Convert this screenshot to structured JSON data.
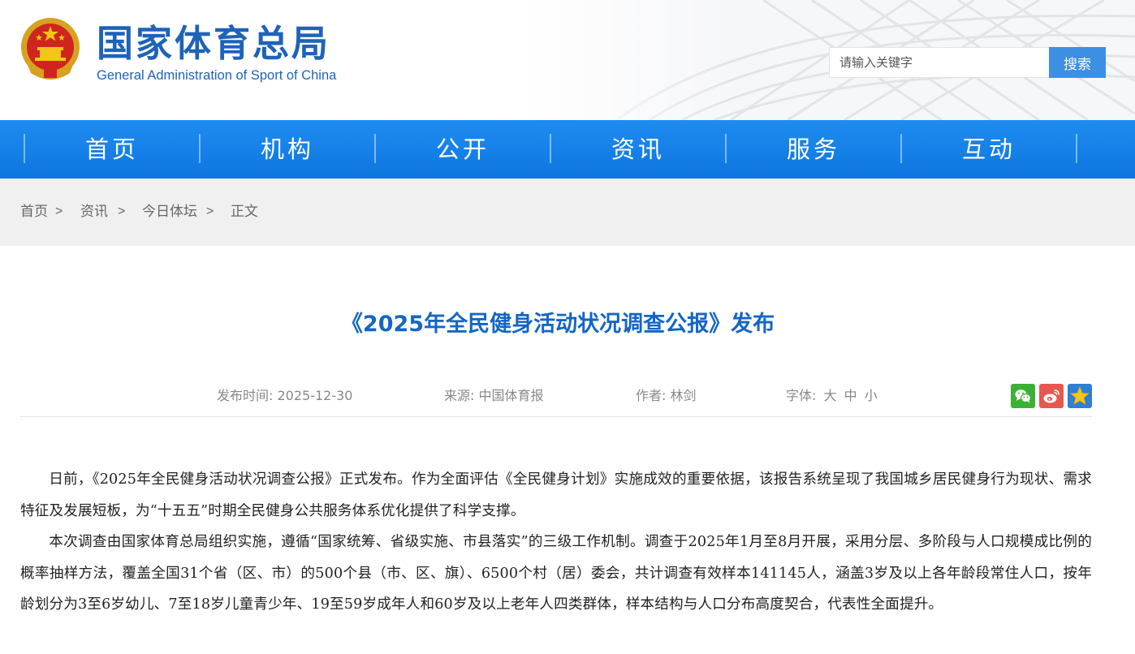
{
  "header": {
    "logo_cn": "国家体育总局",
    "logo_en": "General Administration of Sport of China",
    "search_placeholder": "请输入关键字",
    "search_button": "搜索"
  },
  "nav": {
    "items": [
      {
        "label": "首页"
      },
      {
        "label": "机构"
      },
      {
        "label": "公开"
      },
      {
        "label": "资讯"
      },
      {
        "label": "服务"
      },
      {
        "label": "互动"
      }
    ]
  },
  "breadcrumb": {
    "items": [
      "首页",
      "资讯",
      "今日体坛",
      "正文"
    ],
    "separator": ">"
  },
  "article": {
    "title": "《2025年全民健身活动状况调查公报》发布",
    "meta": {
      "publish_label": "发布时间:",
      "publish_date": "2025-12-30",
      "source_label": "来源:",
      "source": "中国体育报",
      "author_label": "作者:",
      "author": "林剑",
      "font_label": "字体:",
      "font_large": "大",
      "font_medium": "中",
      "font_small": "小"
    },
    "share_icons": [
      "wechat-icon",
      "weibo-icon",
      "favorite-star-icon"
    ],
    "paragraphs": [
      "日前，《2025年全民健身活动状况调查公报》正式发布。作为全面评估《全民健身计划》实施成效的重要依据，该报告系统呈现了我国城乡居民健身行为现状、需求特征及发展短板，为“十五五”时期全民健身公共服务体系优化提供了科学支撑。",
      "本次调查由国家体育总局组织实施，遵循“国家统筹、省级实施、市县落实”的三级工作机制。调查于2025年1月至8月开展，采用分层、多阶段与人口规模成比例的概率抽样方法，覆盖全国31个省（区、市）的500个县（市、区、旗）、6500个村（居）委会，共计调查有效样本141145人，涵盖3岁及以上各年龄段常住人口，按年龄划分为3至6岁幼儿、7至18岁儿童青少年、19至59岁成年人和60岁及以上老年人四类群体，样本结构与人口分布高度契合，代表性全面提升。"
    ]
  },
  "colors": {
    "brand_blue": "#1e63b8",
    "nav_blue": "#0d76e0",
    "title_blue": "#1466c4",
    "search_button": "#3d8fe3",
    "wechat_green": "#3cb034",
    "weibo_red": "#e8574f",
    "favorite_blue": "#2e7fd6"
  }
}
